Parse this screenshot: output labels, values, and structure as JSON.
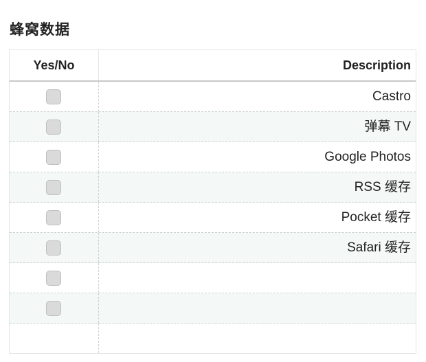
{
  "page": {
    "title": "蜂窝数据"
  },
  "table": {
    "headers": {
      "yes_no": "Yes/No",
      "description": "Description"
    },
    "rows": [
      {
        "checked": false,
        "description": "Castro"
      },
      {
        "checked": false,
        "description": "弹幕 TV"
      },
      {
        "checked": false,
        "description": "Google Photos"
      },
      {
        "checked": false,
        "description": "RSS 缓存"
      },
      {
        "checked": false,
        "description": "Pocket 缓存"
      },
      {
        "checked": false,
        "description": "Safari 缓存"
      },
      {
        "checked": false,
        "description": ""
      },
      {
        "checked": false,
        "description": ""
      },
      {
        "checked": null,
        "description": ""
      }
    ]
  },
  "colors": {
    "checkbox_fill": "#dadada",
    "row_alt_background": "#f4f8f7",
    "divider": "#c9d2d0"
  }
}
